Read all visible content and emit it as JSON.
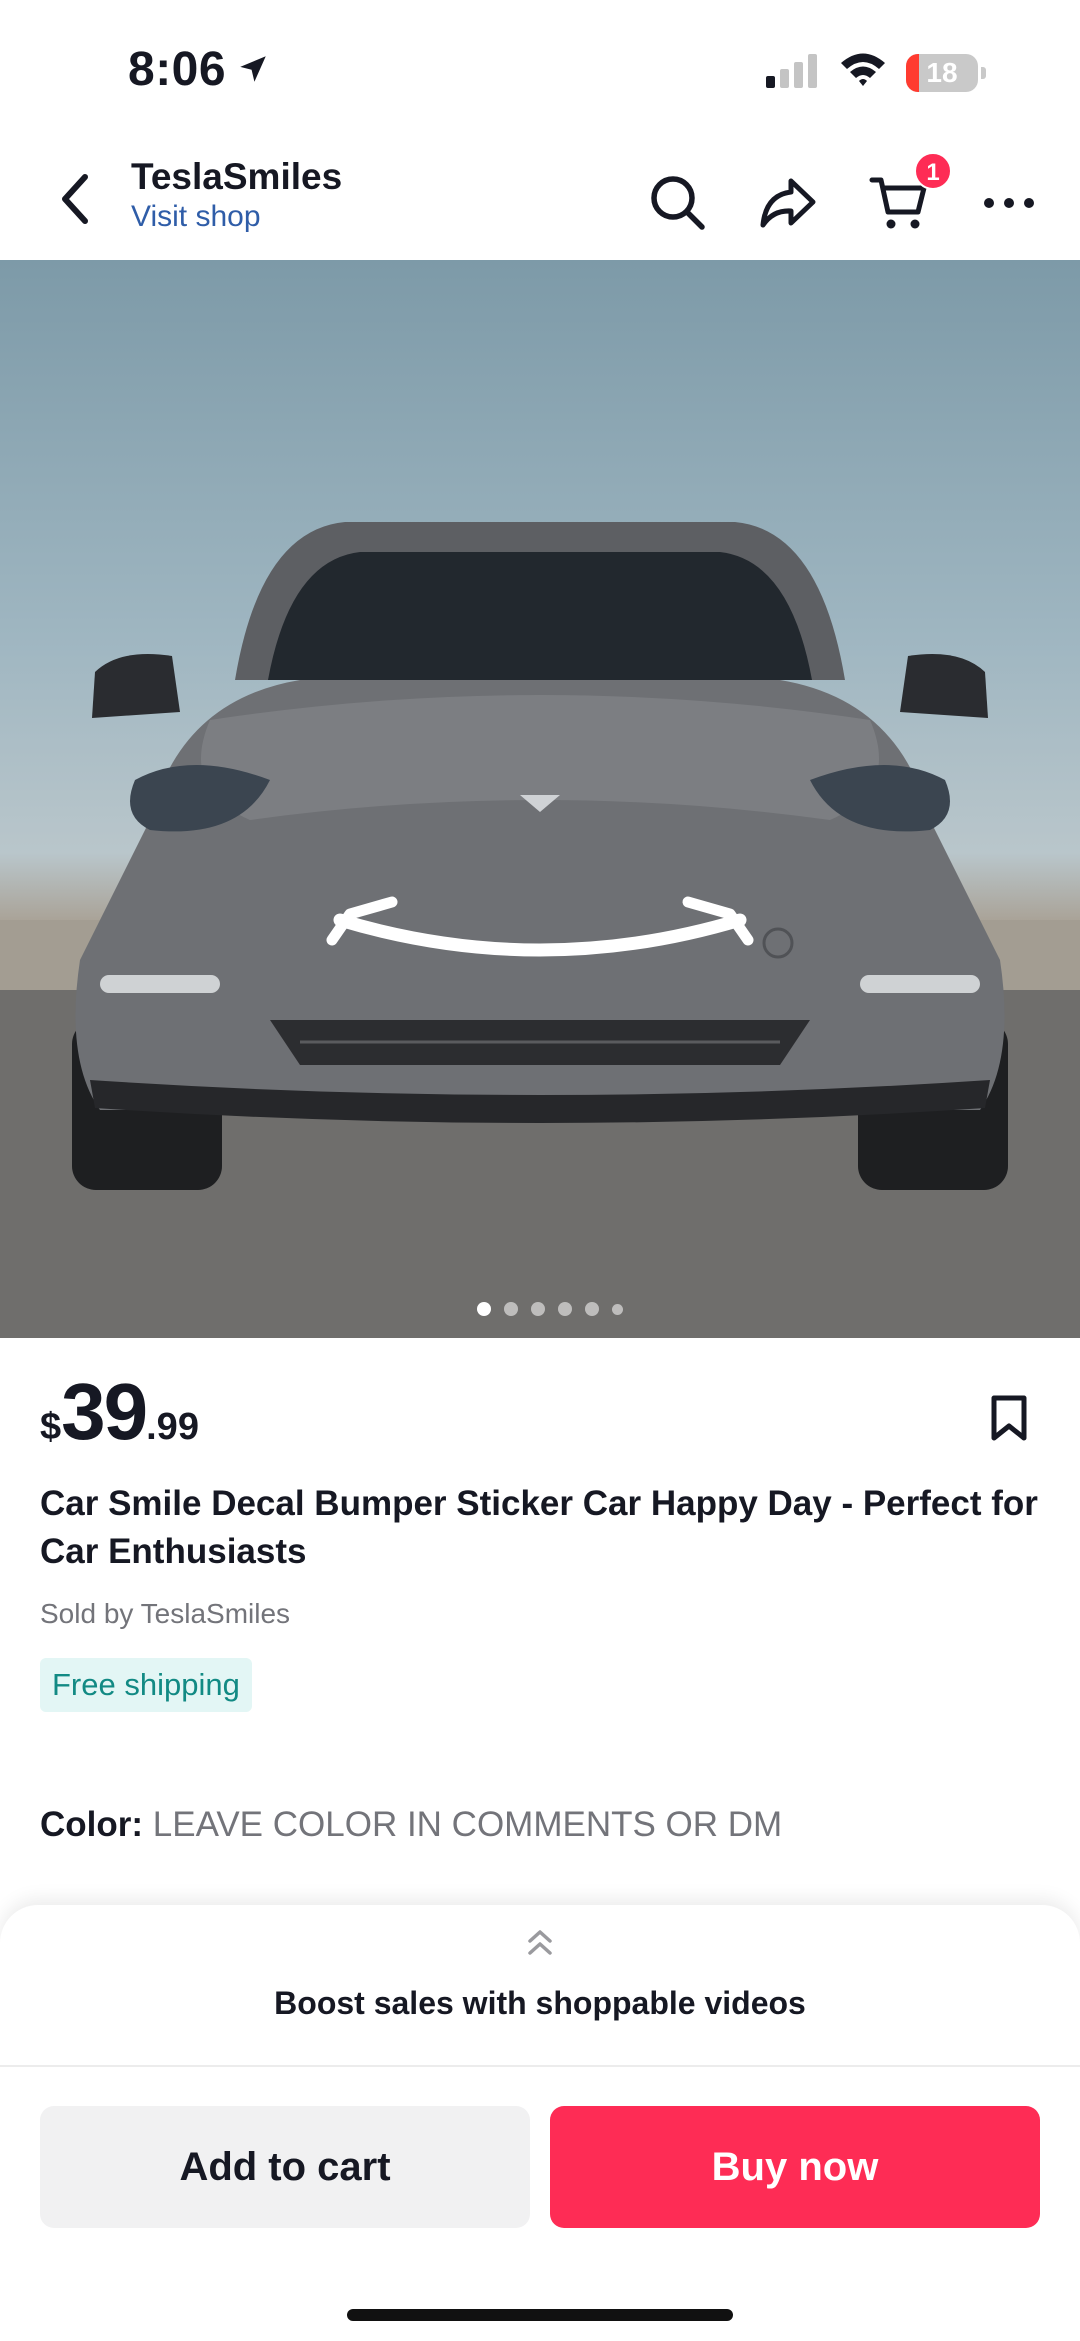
{
  "status_bar": {
    "time": "8:06",
    "battery_level": "18",
    "battery_fraction": 0.18,
    "icons": [
      "location-arrow-icon",
      "cellular-signal-icon",
      "wifi-icon",
      "battery-icon"
    ]
  },
  "header": {
    "shop_name": "TeslaSmiles",
    "visit_shop": "Visit shop",
    "cart_count": "1",
    "icons": [
      "back-icon",
      "search-icon",
      "share-icon",
      "cart-icon",
      "more-icon"
    ]
  },
  "gallery": {
    "image_count": 6,
    "active_index": 0
  },
  "product": {
    "price_currency": "$",
    "price_whole": "39",
    "price_cents": ".99",
    "title": "Car  Smile Decal Bumper Sticker Car Happy Day - Perfect for Car Enthusiasts",
    "sold_by": "Sold by TeslaSmiles",
    "shipping_badge": "Free shipping",
    "color_label": "Color:",
    "color_value": "LEAVE COLOR IN COMMENTS OR DM"
  },
  "bottom_sheet": {
    "promo_text": "Boost sales with shoppable videos",
    "add_to_cart": "Add to cart",
    "buy_now": "Buy now"
  },
  "colors": {
    "accent": "#fe2c55",
    "link": "#2f5da8",
    "shipping_text": "#128a84",
    "shipping_bg": "#e3f6f5"
  }
}
